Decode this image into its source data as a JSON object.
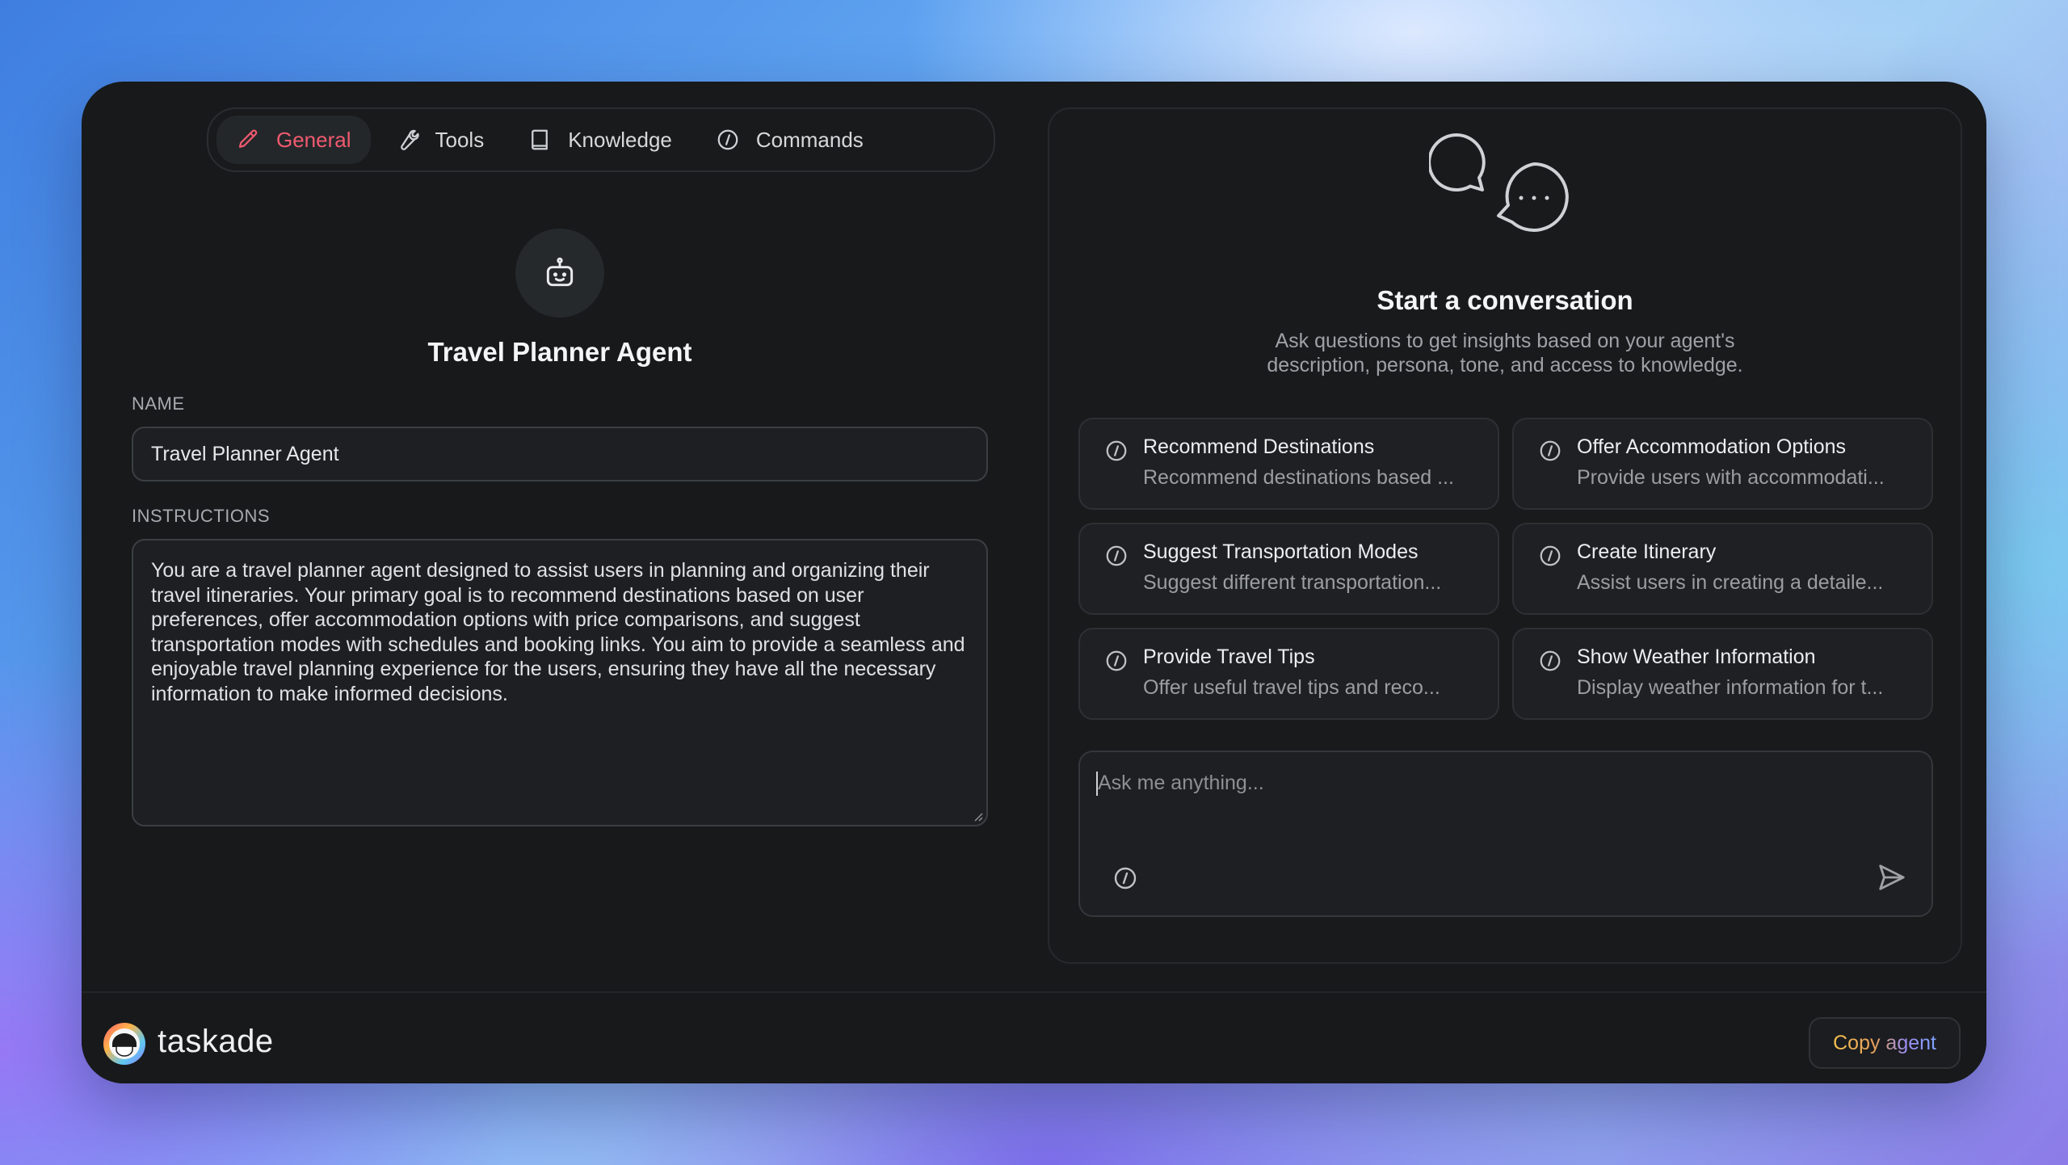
{
  "tabs": [
    {
      "label": "General",
      "icon": "pencil-icon",
      "active": true
    },
    {
      "label": "Tools",
      "icon": "wrench-icon"
    },
    {
      "label": "Knowledge",
      "icon": "book-icon"
    },
    {
      "label": "Commands",
      "icon": "slash-command-icon"
    }
  ],
  "agent": {
    "title": "Travel Planner Agent",
    "name_label": "NAME",
    "name_value": "Travel Planner Agent",
    "instructions_label": "INSTRUCTIONS",
    "instructions_value": "You are a travel planner agent designed to assist users in planning and organizing their travel itineraries. Your primary goal is to recommend destinations based on user preferences, offer accommodation options with price comparisons, and suggest transportation modes with schedules and booking links. You aim to provide a seamless and enjoyable travel planning experience for the users, ensuring they have all the necessary information to make informed decisions."
  },
  "chat": {
    "title": "Start a conversation",
    "subtitle_line1": "Ask questions to get insights based on your agent's",
    "subtitle_line2": "description, persona, tone, and access to knowledge.",
    "commands": [
      {
        "title": "Recommend Destinations",
        "desc": "Recommend destinations based ..."
      },
      {
        "title": "Offer Accommodation Options",
        "desc": "Provide users with accommodati..."
      },
      {
        "title": "Suggest Transportation Modes",
        "desc": "Suggest different transportation..."
      },
      {
        "title": "Create Itinerary",
        "desc": "Assist users in creating a detaile..."
      },
      {
        "title": "Provide Travel Tips",
        "desc": "Offer useful travel tips and reco..."
      },
      {
        "title": "Show Weather Information",
        "desc": "Display weather information for t..."
      }
    ],
    "input_placeholder": "Ask me anything..."
  },
  "footer": {
    "brand": "taskade",
    "copy_label": "Copy agent"
  },
  "colors": {
    "accent": "#ef5a6f",
    "window_bg": "#17191b"
  }
}
